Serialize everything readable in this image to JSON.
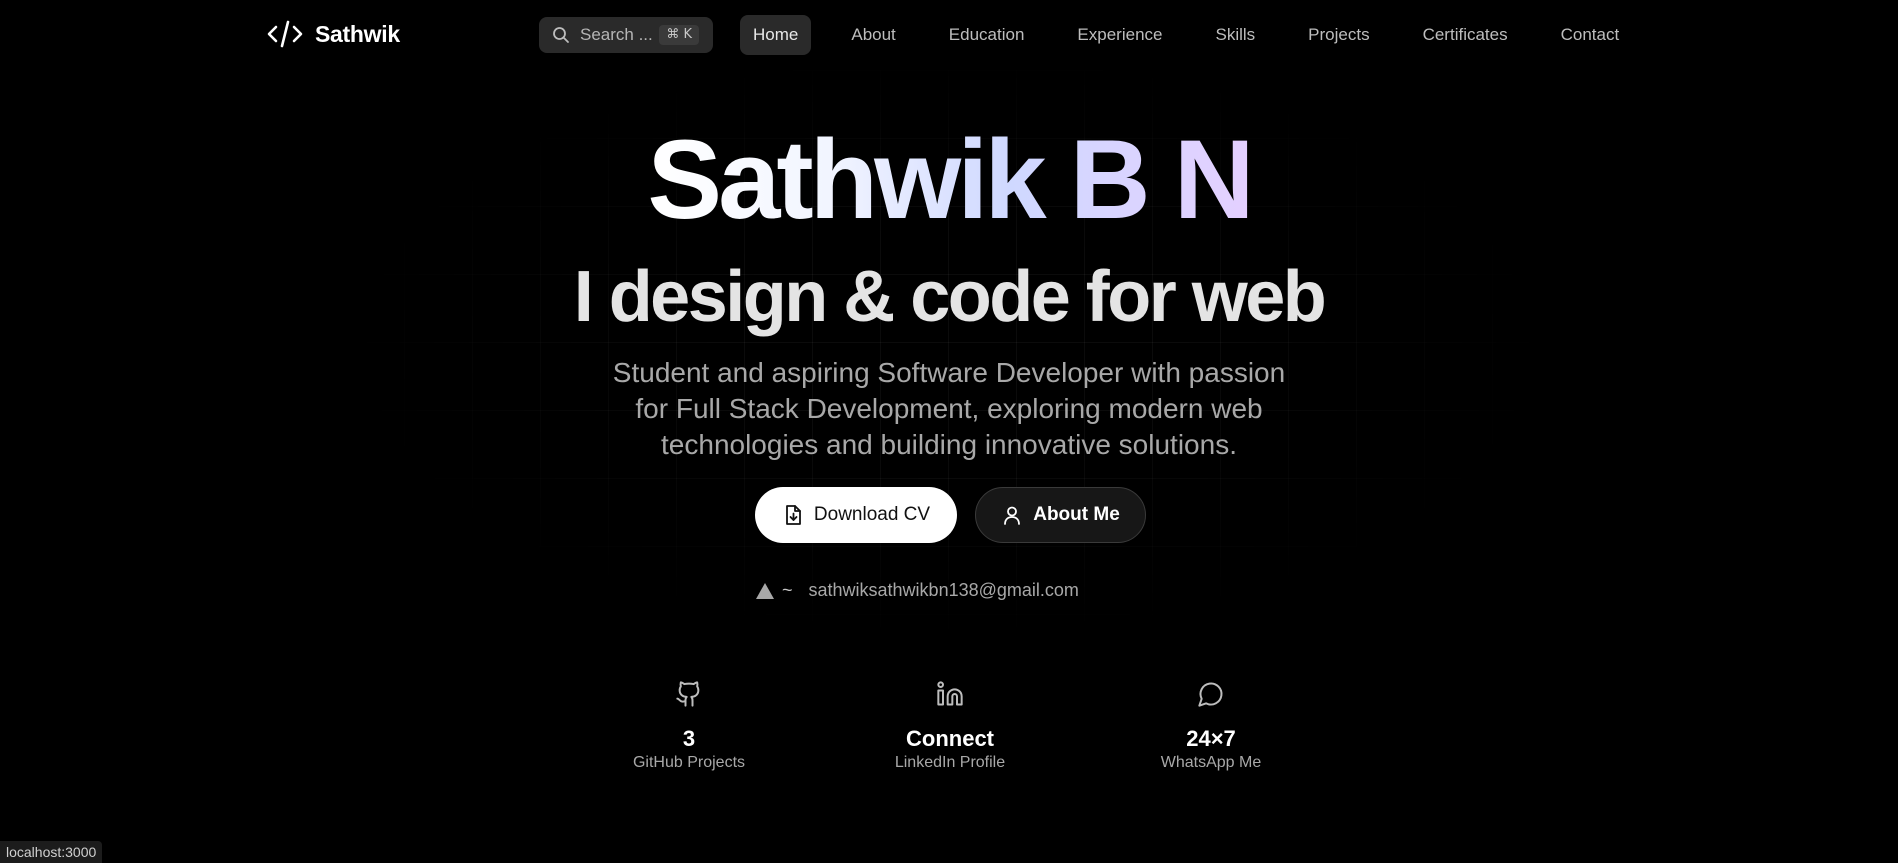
{
  "nav": {
    "logo_text": "Sathwik",
    "search_placeholder": "Search ...",
    "search_shortcut": "⌘ K",
    "links": [
      {
        "label": "Home",
        "active": true
      },
      {
        "label": "About"
      },
      {
        "label": "Education"
      },
      {
        "label": "Experience"
      },
      {
        "label": "Skills"
      },
      {
        "label": "Projects"
      },
      {
        "label": "Certificates"
      },
      {
        "label": "Contact"
      }
    ]
  },
  "hero": {
    "name": "Sathwik B N",
    "tagline": "I design & code for web",
    "description": "Student and aspiring Software Developer with passion for Full Stack Development, exploring modern web technologies and building innovative solutions.",
    "buttons": {
      "download_cv": "Download CV",
      "about_me": "About Me"
    },
    "prompt_symbol": "~",
    "email": "sathwiksathwikbn138@gmail.com"
  },
  "stats": [
    {
      "icon": "github-icon",
      "value": "3",
      "label": "GitHub Projects"
    },
    {
      "icon": "linkedin-icon",
      "value": "Connect",
      "label": "LinkedIn Profile"
    },
    {
      "icon": "chat-bubble-icon",
      "value": "24×7",
      "label": "WhatsApp Me"
    }
  ],
  "status_bar": {
    "url": "localhost:3000"
  },
  "colors": {
    "background": "#000000",
    "nav_active_bg": "#2a2a2a",
    "text_muted": "#a8a8a8",
    "primary_button_bg": "#ffffff",
    "name_gradient_end": "#e4d0ff"
  }
}
